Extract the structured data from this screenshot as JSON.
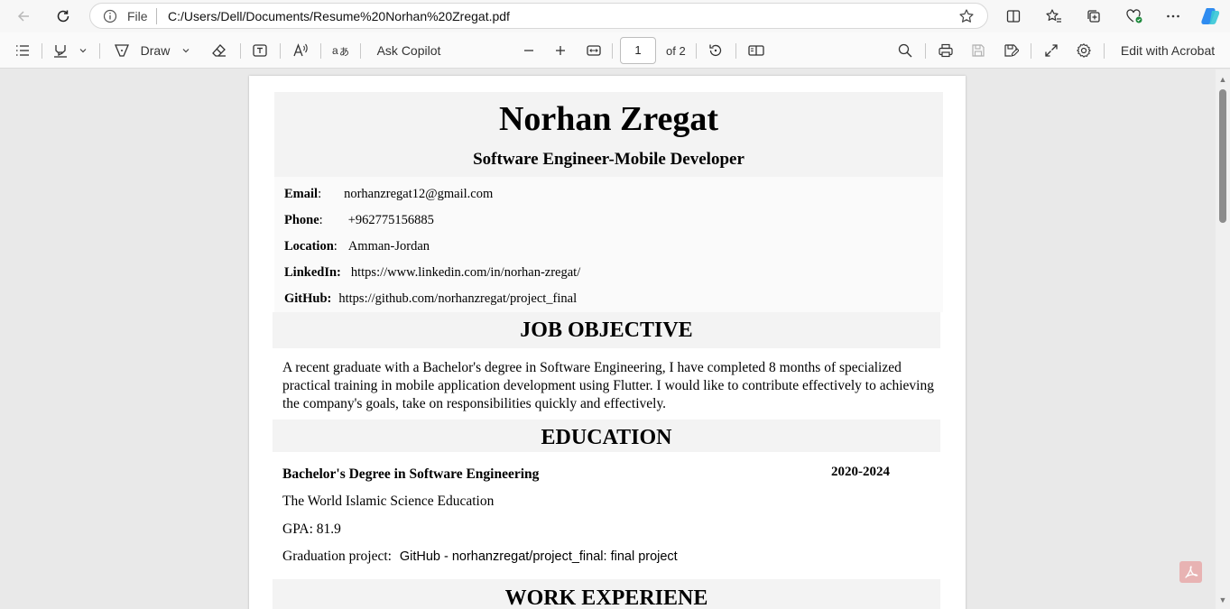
{
  "address_bar": {
    "file_label": "File",
    "url": "C:/Users/Dell/Documents/Resume%20Norhan%20Zregat.pdf"
  },
  "pdf_toolbar": {
    "draw_label": "Draw",
    "ask_copilot_label": "Ask Copilot",
    "page_current": "1",
    "page_total_label": "of 2",
    "edit_acrobat_label": "Edit with Acrobat"
  },
  "resume": {
    "name": "Norhan Zregat",
    "title": "Software Engineer-Mobile Developer",
    "contact": {
      "email_label": "Email",
      "email_colon": ":",
      "email": "norhanzregat12@gmail.com",
      "phone_label": "Phone",
      "phone_colon": ":",
      "phone": "+962775156885",
      "location_label": "Location",
      "location_colon": ":",
      "location": "Amman-Jordan",
      "linkedin_label": "LinkedIn:",
      "linkedin": "https://www.linkedin.com/in/norhan-zregat/",
      "github_label": "GitHub:",
      "github": "https://github.com/norhanzregat/project_final"
    },
    "objective_heading": "JOB OBJECTIVE",
    "objective_text": "A recent graduate with a Bachelor's degree in Software Engineering, I have completed 8 months of specialized practical training in mobile application development using Flutter. I would like to contribute effectively to achieving the company's goals, take on responsibilities quickly and effectively.",
    "education_heading": "EDUCATION",
    "education": {
      "degree": "Bachelor's Degree in Software Engineering",
      "years": "2020-2024",
      "school": "The World Islamic Science Education",
      "gpa": "GPA: 81.9",
      "project_label": "Graduation project:",
      "project_link": "GitHub - norhanzregat/project_final: final project"
    },
    "work_heading": "WORK EXPERIENE"
  },
  "colors": {
    "section_bg": "#f3f3f3",
    "viewer_bg": "#e9e9e9",
    "acrobat_badge": "#e8b3b3"
  }
}
